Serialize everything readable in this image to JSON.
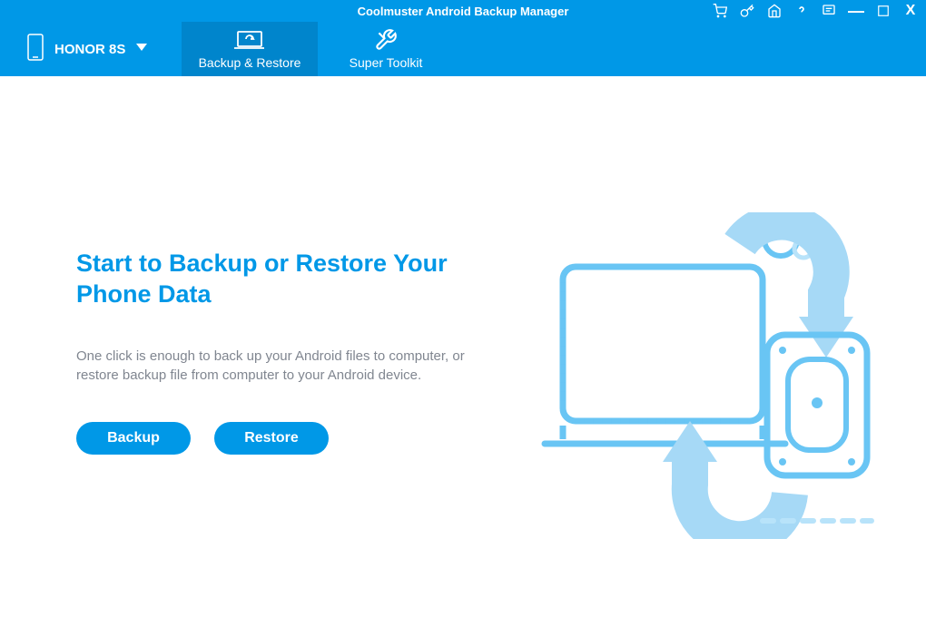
{
  "app": {
    "title": "Coolmuster Android Backup Manager"
  },
  "device": {
    "name": "HONOR 8S"
  },
  "nav": {
    "backup_restore": "Backup & Restore",
    "super_toolkit": "Super Toolkit"
  },
  "main": {
    "headline": "Start to Backup or Restore Your Phone Data",
    "description": "One click is enough to back up your Android files to computer, or restore backup file from computer to your Android device.",
    "backup_label": "Backup",
    "restore_label": "Restore"
  },
  "titlebar_icons": {
    "cart": "cart-icon",
    "key": "key-icon",
    "home": "home-icon",
    "help": "help-icon",
    "feedback": "feedback-icon",
    "minimize": "minimize-icon",
    "maximize": "maximize-icon",
    "close": "close-icon"
  }
}
